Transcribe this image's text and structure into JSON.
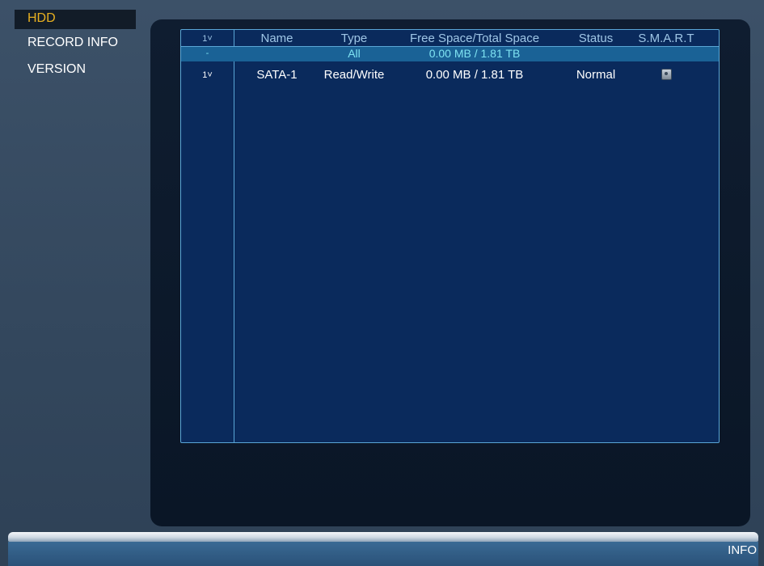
{
  "menu": {
    "items": [
      {
        "label": "HDD",
        "active": true
      },
      {
        "label": "RECORD INFO",
        "active": false
      },
      {
        "label": "VERSION",
        "active": false
      }
    ]
  },
  "table": {
    "headers": {
      "num": "1˅",
      "name": "Name",
      "type": "Type",
      "space": "Free Space/Total Space",
      "status": "Status",
      "smart": "S.M.A.R.T"
    },
    "summary_row": {
      "num": "-",
      "name": "",
      "type": "All",
      "space": "0.00 MB / 1.81 TB",
      "status": "",
      "smart": ""
    },
    "rows": [
      {
        "num": "1˅",
        "name": "SATA-1",
        "type": "Read/Write",
        "space": "0.00 MB / 1.81 TB",
        "status": "Normal",
        "smart": "smart-detail-icon"
      }
    ]
  },
  "footer": {
    "label": "INFO"
  },
  "colors": {
    "active_menu_text": "#e8b020",
    "table_border": "#5aa6d6",
    "summary_row_bg": "#1a6296",
    "summary_text": "#7fe3f2"
  }
}
